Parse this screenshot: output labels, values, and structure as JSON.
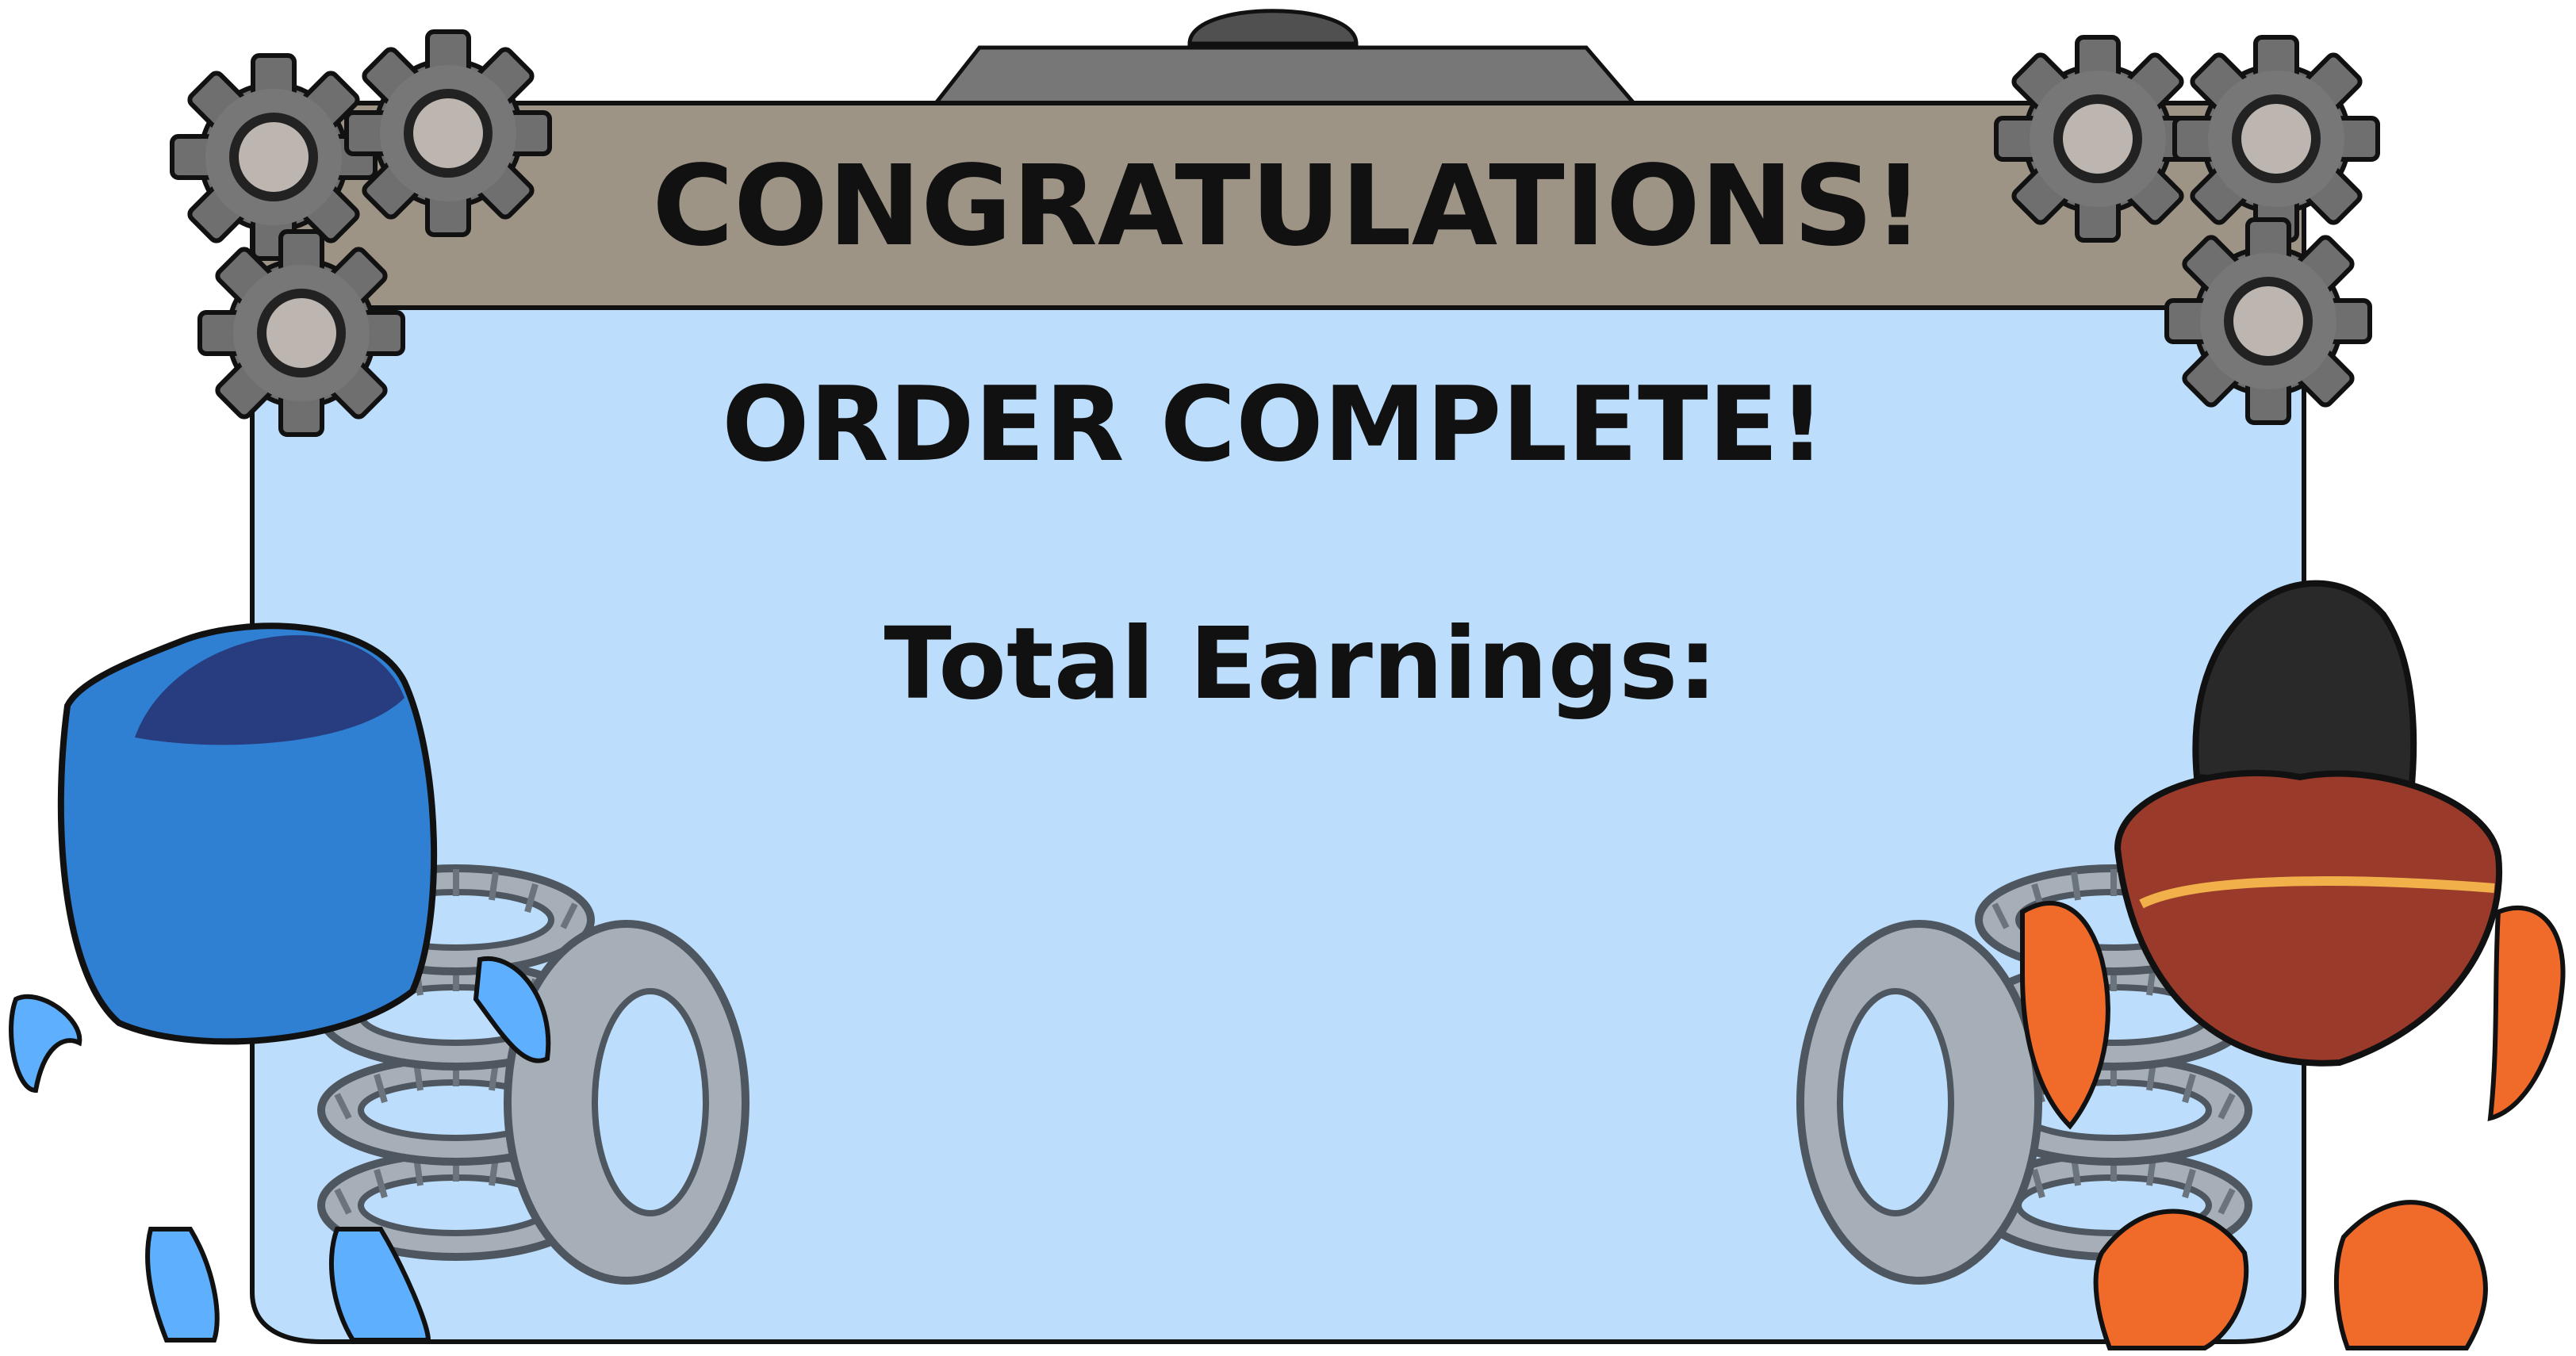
{
  "screen": {
    "title": "CONGRATULATIONS!",
    "heading": "ORDER COMPLETE!",
    "earnings_label": "Total Earnings:"
  },
  "colors": {
    "panel_fill": "#bcdefc",
    "header_fill": "#9e9486",
    "outline": "#111111",
    "gear": "#6f6f6f",
    "tire": "#7c8690",
    "blue_robot": "#2f7fd2",
    "red_robot": "#9a3a2b",
    "orange_parts": "#f06a2a"
  },
  "icons": {
    "gears": "gear-icon",
    "tires": "tire-stack-icon",
    "left_character": "blue-robot-character",
    "right_character": "red-robot-character"
  }
}
